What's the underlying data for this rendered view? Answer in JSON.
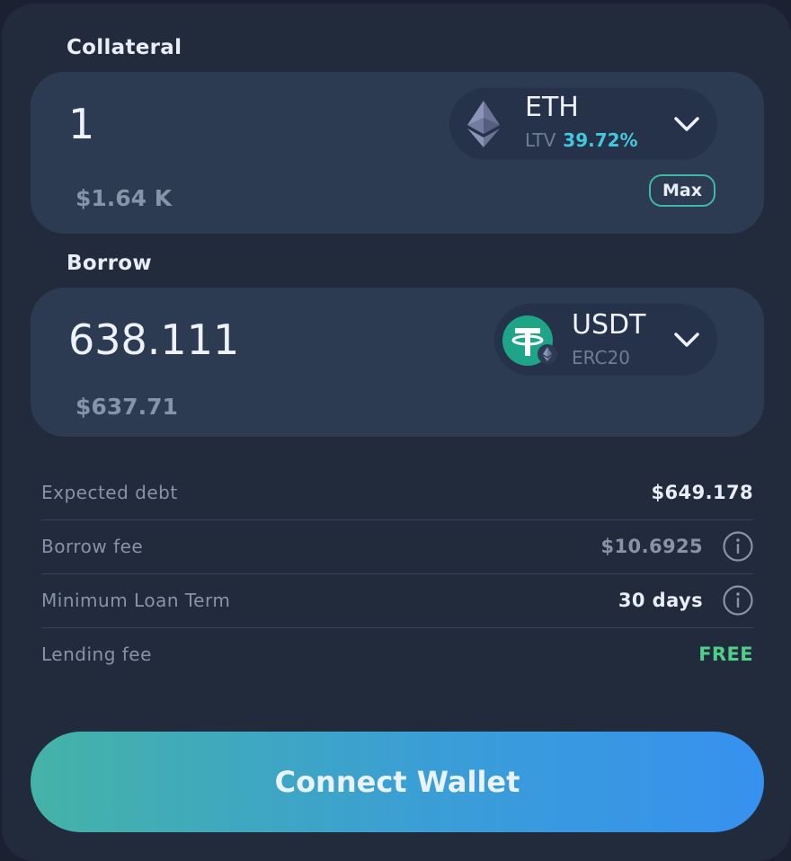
{
  "collateral": {
    "label": "Collateral",
    "amount": "1",
    "usd_value": "$1.64 K",
    "token": {
      "symbol": "ETH",
      "ltv_label": "LTV",
      "ltv_value": "39.72%",
      "icon": "ethereum-icon"
    },
    "max_label": "Max"
  },
  "borrow": {
    "label": "Borrow",
    "amount": "638.111",
    "usd_value": "$637.71",
    "token": {
      "symbol": "USDT",
      "network": "ERC20",
      "icon": "tether-icon",
      "network_icon": "ethereum-icon"
    }
  },
  "details": [
    {
      "label": "Expected debt",
      "value": "$649.178",
      "color": "#e8edf6",
      "info": false
    },
    {
      "label": "Borrow fee",
      "value": "$10.6925",
      "color": "#8793a8",
      "info": true
    },
    {
      "label": "Minimum Loan Term",
      "value": "30 days",
      "color": "#e8edf6",
      "info": true
    },
    {
      "label": "Lending fee",
      "value": "FREE",
      "color": "#4fcf8a",
      "info": false
    }
  ],
  "connect_button": {
    "label": "Connect Wallet"
  },
  "colors": {
    "background": "#222b3c",
    "panel": "#2d3b52",
    "accent_teal": "#45c7dc",
    "free_green": "#4fcf8a",
    "button_gradient_start": "#44b3a7",
    "button_gradient_end": "#3691ef"
  }
}
